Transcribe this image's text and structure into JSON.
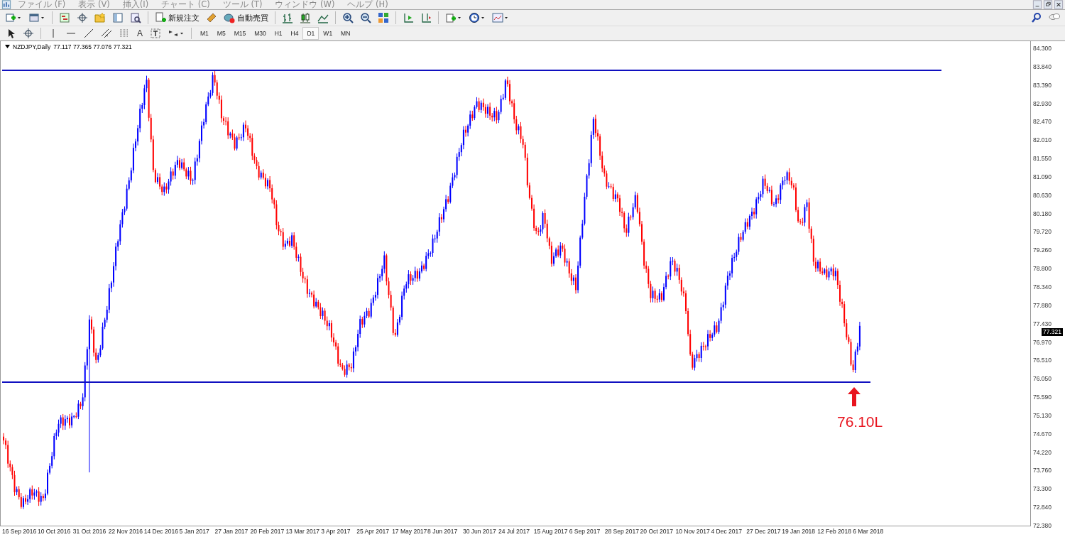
{
  "menu": [
    "ファイル (F)",
    "表示 (V)",
    "挿入(I)",
    "チャート (C)",
    "ツール (T)",
    "ウィンドウ (W)",
    "ヘルプ (H)"
  ],
  "toolbar": {
    "order_button": "新規注文",
    "autotrade_button": "自動売買"
  },
  "drawing_toolbar": {
    "text_tool": "A"
  },
  "timeframes": [
    {
      "label": "M1",
      "selected": false
    },
    {
      "label": "M5",
      "selected": false
    },
    {
      "label": "M15",
      "selected": false
    },
    {
      "label": "M30",
      "selected": false
    },
    {
      "label": "H1",
      "selected": false
    },
    {
      "label": "H4",
      "selected": false
    },
    {
      "label": "D1",
      "selected": true
    },
    {
      "label": "W1",
      "selected": false
    },
    {
      "label": "MN",
      "selected": false
    }
  ],
  "chart": {
    "symbol": "NZDJPY,Daily",
    "ohlc": "77.117 77.365 77.076 77.321",
    "price_axis": [
      "84.300",
      "83.840",
      "83.390",
      "82.930",
      "82.470",
      "82.010",
      "81.550",
      "81.090",
      "80.630",
      "80.180",
      "79.720",
      "79.260",
      "78.800",
      "78.340",
      "77.880",
      "77.430",
      "76.970",
      "76.510",
      "76.050",
      "75.590",
      "75.130",
      "74.670",
      "74.220",
      "73.760",
      "73.300",
      "72.840",
      "72.380"
    ],
    "current_price": "77.321",
    "time_axis": [
      "16 Sep 2016",
      "10 Oct 2016",
      "31 Oct 2016",
      "22 Nov 2016",
      "14 Dec 2016",
      "5 Jan 2017",
      "27 Jan 2017",
      "20 Feb 2017",
      "13 Mar 2017",
      "3 Apr 2017",
      "25 Apr 2017",
      "17 May 2017",
      "8 Jun 2017",
      "30 Jun 2017",
      "24 Jul 2017",
      "15 Aug 2017",
      "6 Sep 2017",
      "28 Sep 2017",
      "20 Oct 2017",
      "10 Nov 2017",
      "4 Dec 2017",
      "27 Dec 2017",
      "19 Jan 2018",
      "12 Feb 2018",
      "6 Mar 2018"
    ],
    "annotation": "76.10L"
  }
}
